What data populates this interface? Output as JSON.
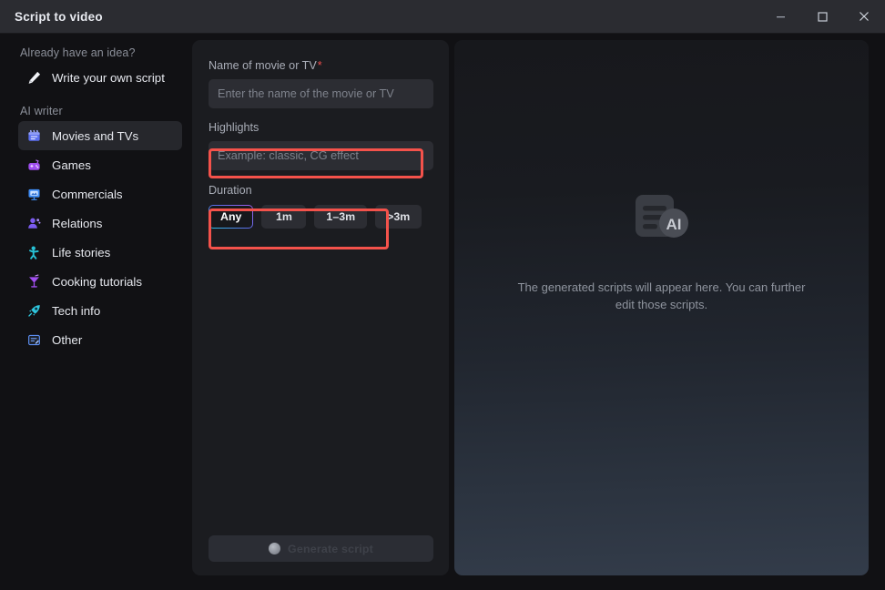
{
  "window": {
    "title": "Script to video",
    "controls": {
      "minimize": "minimize-button",
      "maximize": "maximize-button",
      "close": "close-button"
    }
  },
  "sidebar": {
    "section_idea": "Already have an idea?",
    "own_script": {
      "label": "Write your own script",
      "icon": "pencil-icon"
    },
    "section_ai": "AI writer",
    "items": [
      {
        "label": "Movies and TVs",
        "icon": "clapperboard-icon",
        "selected": true
      },
      {
        "label": "Games",
        "icon": "gamepad-icon",
        "selected": false
      },
      {
        "label": "Commercials",
        "icon": "presentation-icon",
        "selected": false
      },
      {
        "label": "Relations",
        "icon": "people-icon",
        "selected": false
      },
      {
        "label": "Life stories",
        "icon": "person-icon",
        "selected": false
      },
      {
        "label": "Cooking tutorials",
        "icon": "cocktail-icon",
        "selected": false
      },
      {
        "label": "Tech info",
        "icon": "rocket-icon",
        "selected": false
      },
      {
        "label": "Other",
        "icon": "note-icon",
        "selected": false
      }
    ]
  },
  "form": {
    "name_label": "Name of movie or TV",
    "name_required_marker": "*",
    "name_value": "",
    "name_placeholder": "Enter the name of the movie or TV",
    "highlights_label": "Highlights",
    "highlights_value": "",
    "highlights_placeholder": "Example: classic, CG effect",
    "duration_label": "Duration",
    "duration_options": [
      "Any",
      "1m",
      "1–3m",
      ">3m"
    ],
    "duration_selected": "Any",
    "generate_label": "Generate script"
  },
  "preview": {
    "empty_text": "The generated scripts will appear here. You can further edit those scripts.",
    "icon": "ai-document-icon",
    "badge_text": "AI"
  },
  "colors": {
    "accent_red": "#f4524b",
    "required_red": "#ef4c4c",
    "chip_gradient_start": "#29c5e8",
    "chip_gradient_end": "#a25de8",
    "titlebar_bg": "#2b2c31",
    "panel_bg": "#1b1c20"
  }
}
